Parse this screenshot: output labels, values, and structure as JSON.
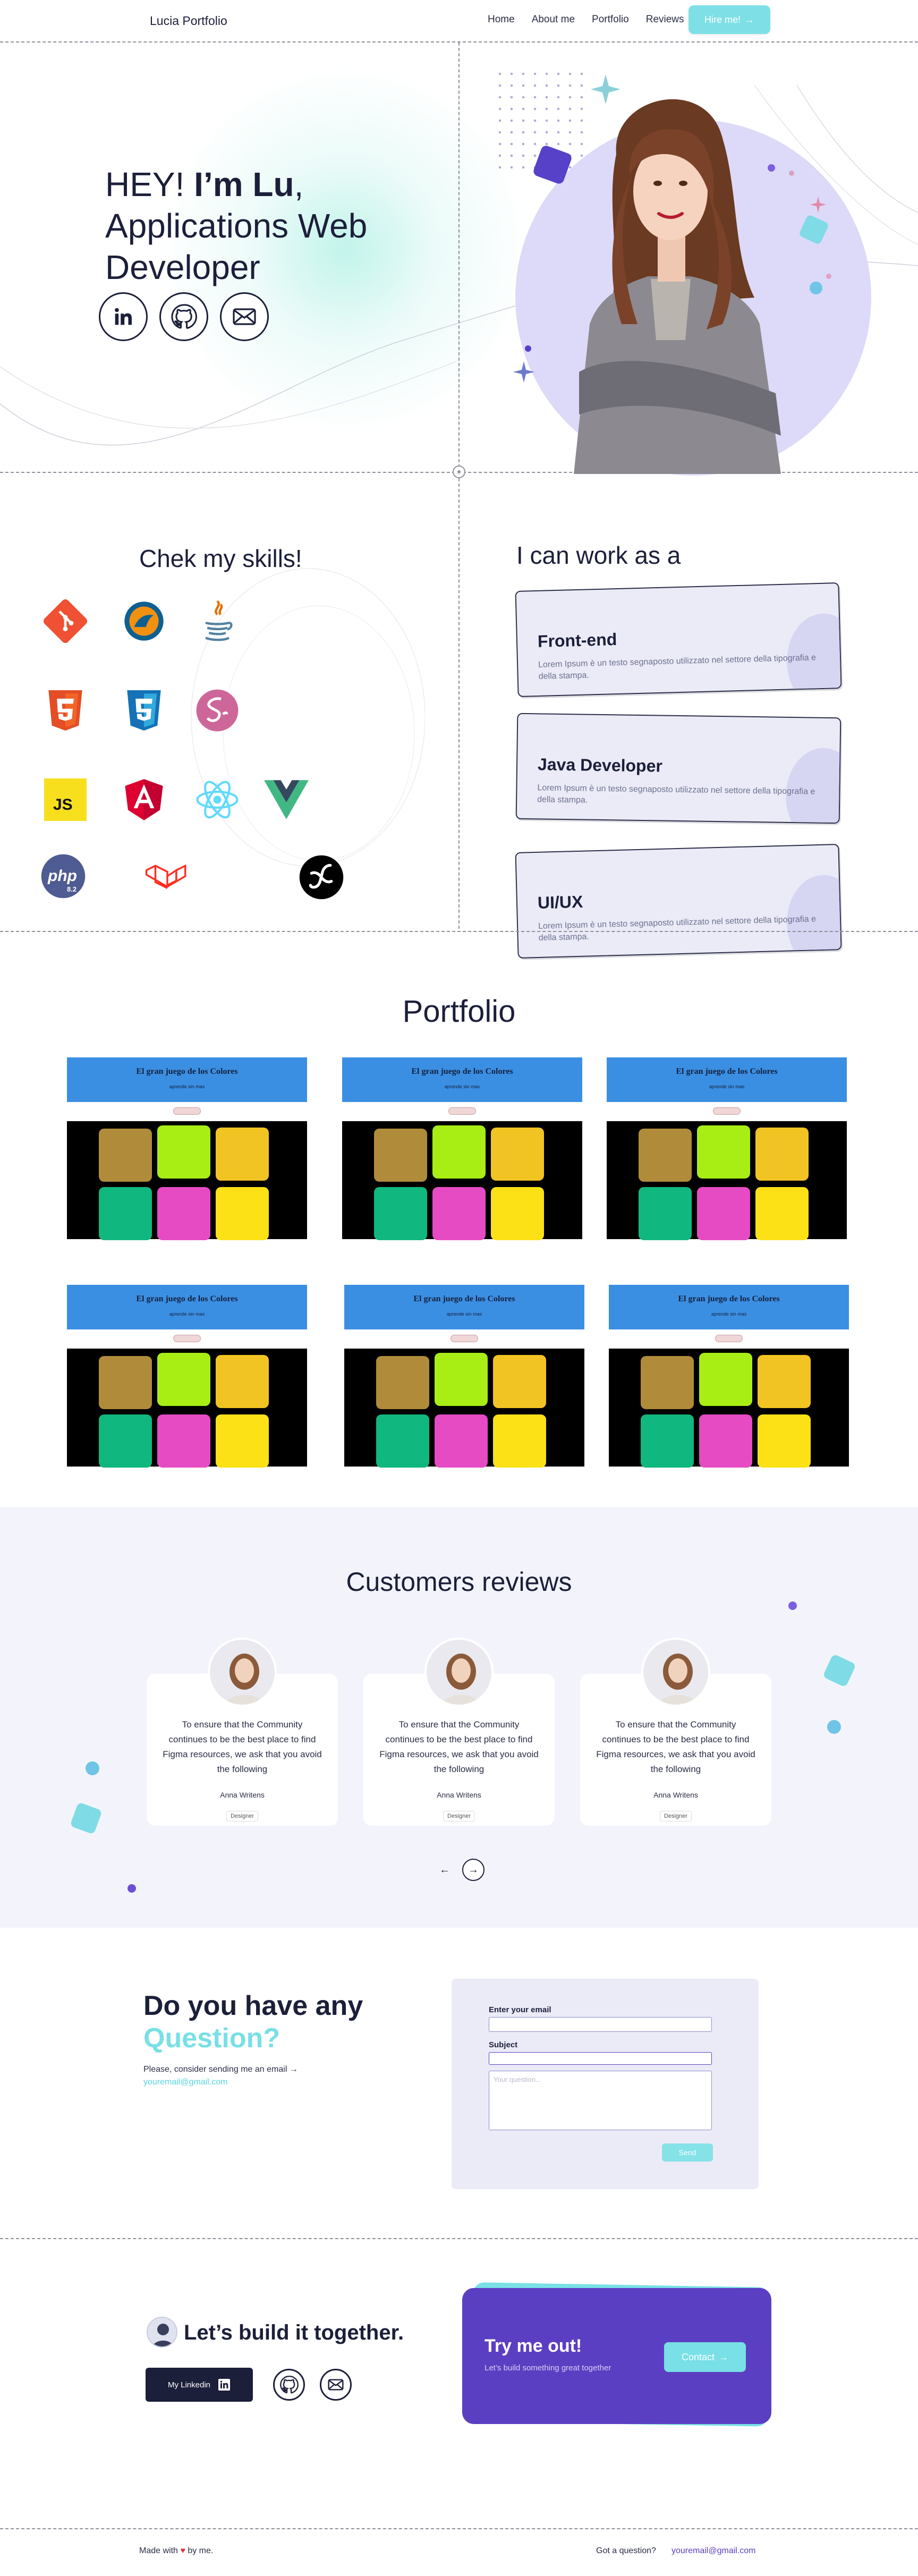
{
  "nav": {
    "brand": "Lucia Portfolio",
    "links": [
      "Home",
      "About me",
      "Portfolio",
      "Reviews"
    ],
    "hire_label": "Hire me!",
    "hire_arrow": "→"
  },
  "hero": {
    "greeting_plain": "HEY! ",
    "greeting_bold": "I’m Lu",
    "greeting_tail": ",",
    "line2": "Applications Web",
    "line3": "Developer",
    "social_icons": [
      "linkedin-icon",
      "github-icon",
      "mail-icon"
    ]
  },
  "skills": {
    "title": "Chek my skills!",
    "icons": [
      "git-icon",
      "mysql-icon",
      "java-icon",
      "html5-icon",
      "css3-icon",
      "sass-icon",
      "javascript-icon",
      "angular-icon",
      "react-icon",
      "vue-icon",
      "php-icon",
      "laravel-icon",
      "symfony-icon"
    ],
    "php_label": "php",
    "php_version": "8.2",
    "js_label": "JS"
  },
  "work": {
    "title": "I can work as a",
    "cards": [
      {
        "title": "Front-end",
        "text": "Lorem Ipsum è un testo segnaposto utilizzato nel settore della tipografia e della stampa."
      },
      {
        "title": "Java Developer",
        "text": "Lorem Ipsum è un testo segnaposto utilizzato nel settore della tipografia e della stampa."
      },
      {
        "title": "UI/UX",
        "text": "Lorem Ipsum è un testo segnaposto utilizzato nel settore della tipografia e della stampa."
      }
    ]
  },
  "portfolio": {
    "title": "Portfolio",
    "project_title": "El gran juego de los Colores",
    "project_sub": "aprende sin mas",
    "tile_colors": [
      "#b08b3a",
      "#a8ee14",
      "#f2c423",
      "#10b77f",
      "#e64bc3",
      "#fbe116"
    ]
  },
  "reviews": {
    "title": "Customers reviews",
    "items": [
      {
        "text": "To ensure that the Community continues to be the best place to find Figma resources, we ask that you avoid the following",
        "name": "Anna Writens",
        "role": "Designer"
      },
      {
        "text": "To ensure that the Community continues to be the best place to find Figma resources, we ask that you avoid the following",
        "name": "Anna Writens",
        "role": "Designer"
      },
      {
        "text": "To ensure that the Community continues to be the best place to find Figma resources, we ask that you avoid the following",
        "name": "Anna Writens",
        "role": "Designer"
      }
    ],
    "prev": "←",
    "next": "→"
  },
  "contact": {
    "title_line1": "Do you have any",
    "title_line2": "Question?",
    "sub": "Please, consider sending me an email →",
    "email": "youremail@gmail.com",
    "email_label": "Enter your email",
    "subject_label": "Subject",
    "question_placeholder": "Your question...",
    "send_label": "Send"
  },
  "build": {
    "title": "Let’s build it together.",
    "linkedin_label": "My Linkedin",
    "try_title": "Try me out!",
    "try_sub": "Let’s build something great together",
    "contact_label": "Contact",
    "contact_arrow": "→"
  },
  "footer": {
    "made_with_pre": "Made with",
    "made_with_post": "by me.",
    "question": "Got a question?",
    "email": "youremail@gmail.com"
  },
  "colors": {
    "accent_cyan": "#78e0e6",
    "accent_purple": "#5b3fc2",
    "dark": "#1c1f3a",
    "portfolio_blue": "#3b8fe3"
  }
}
